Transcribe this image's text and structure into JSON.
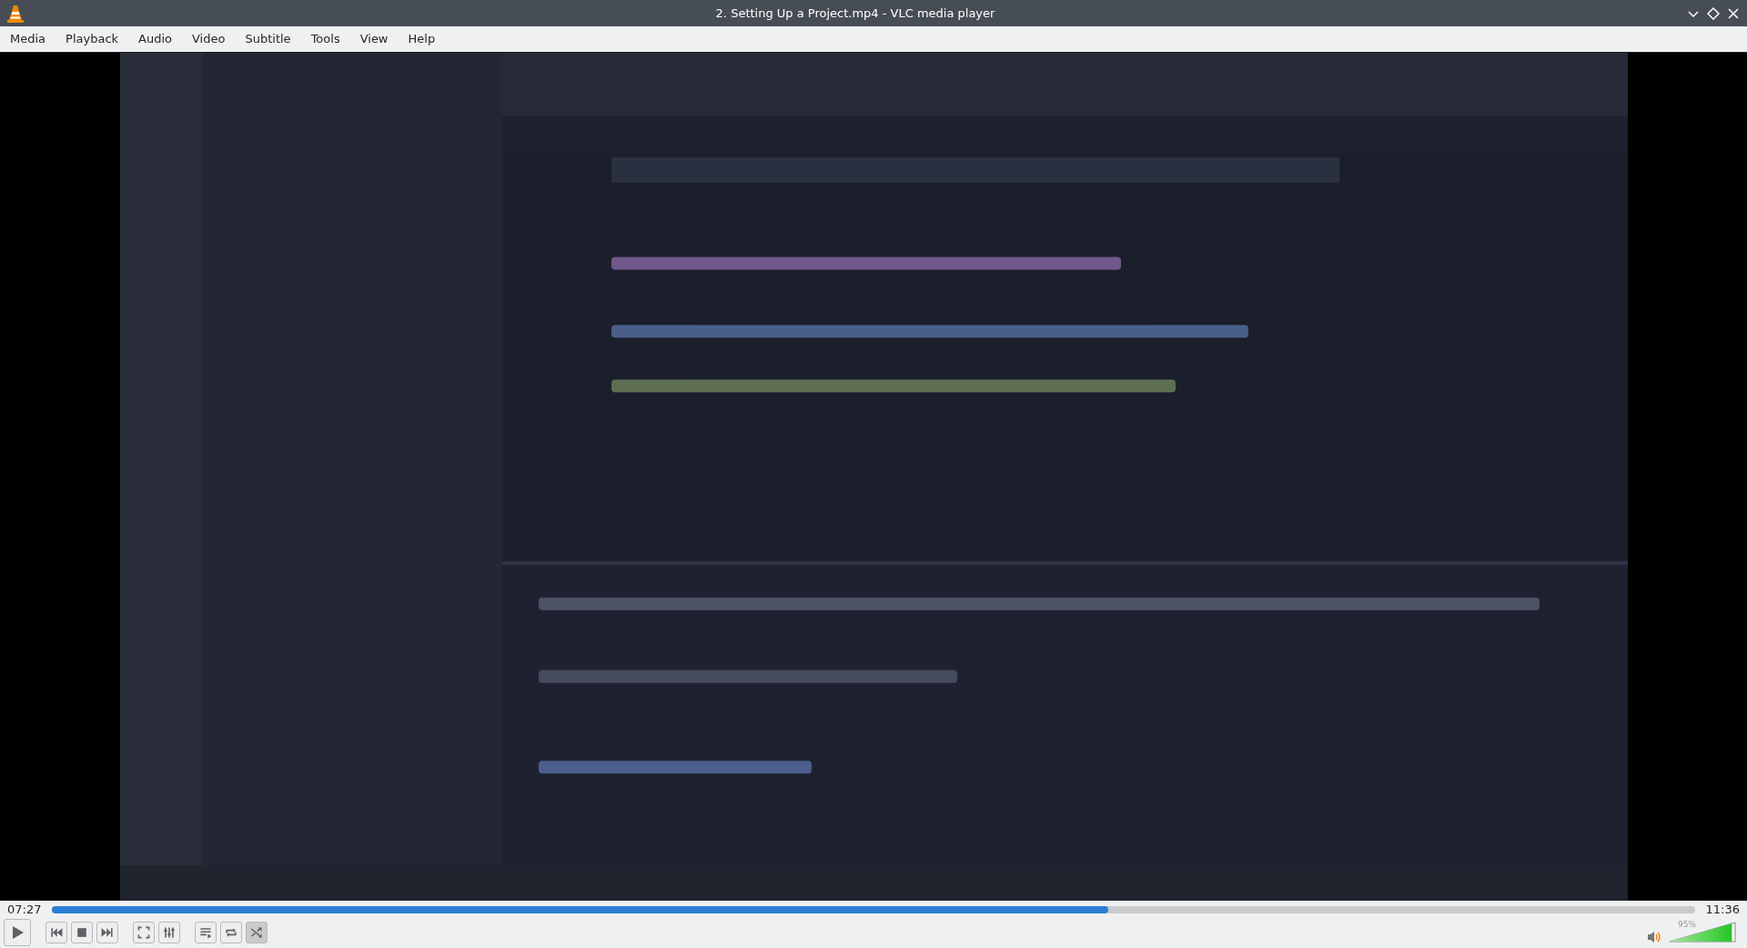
{
  "window": {
    "title": "2. Setting Up a Project.mp4 - VLC media player"
  },
  "menu": [
    "Media",
    "Playback",
    "Audio",
    "Video",
    "Subtitle",
    "Tools",
    "View",
    "Help"
  ],
  "video": {
    "kind": "picture"
  },
  "seek": {
    "elapsed": "07:27",
    "total": "11:36",
    "level": 0.643
  },
  "controls": [
    {
      "kind": "play",
      "selected": false
    },
    {
      "kind": "prev",
      "selected": false
    },
    {
      "kind": "stop",
      "selected": false
    },
    {
      "kind": "next",
      "selected": false
    },
    {
      "kind": "fullscreen",
      "selected": false
    },
    {
      "kind": "extended",
      "selected": false
    },
    {
      "kind": "playlist",
      "selected": false
    },
    {
      "kind": "loop",
      "selected": false
    },
    {
      "kind": "shuffle",
      "selected": true
    }
  ],
  "volume": {
    "reading": "95%",
    "level": 0.95
  }
}
